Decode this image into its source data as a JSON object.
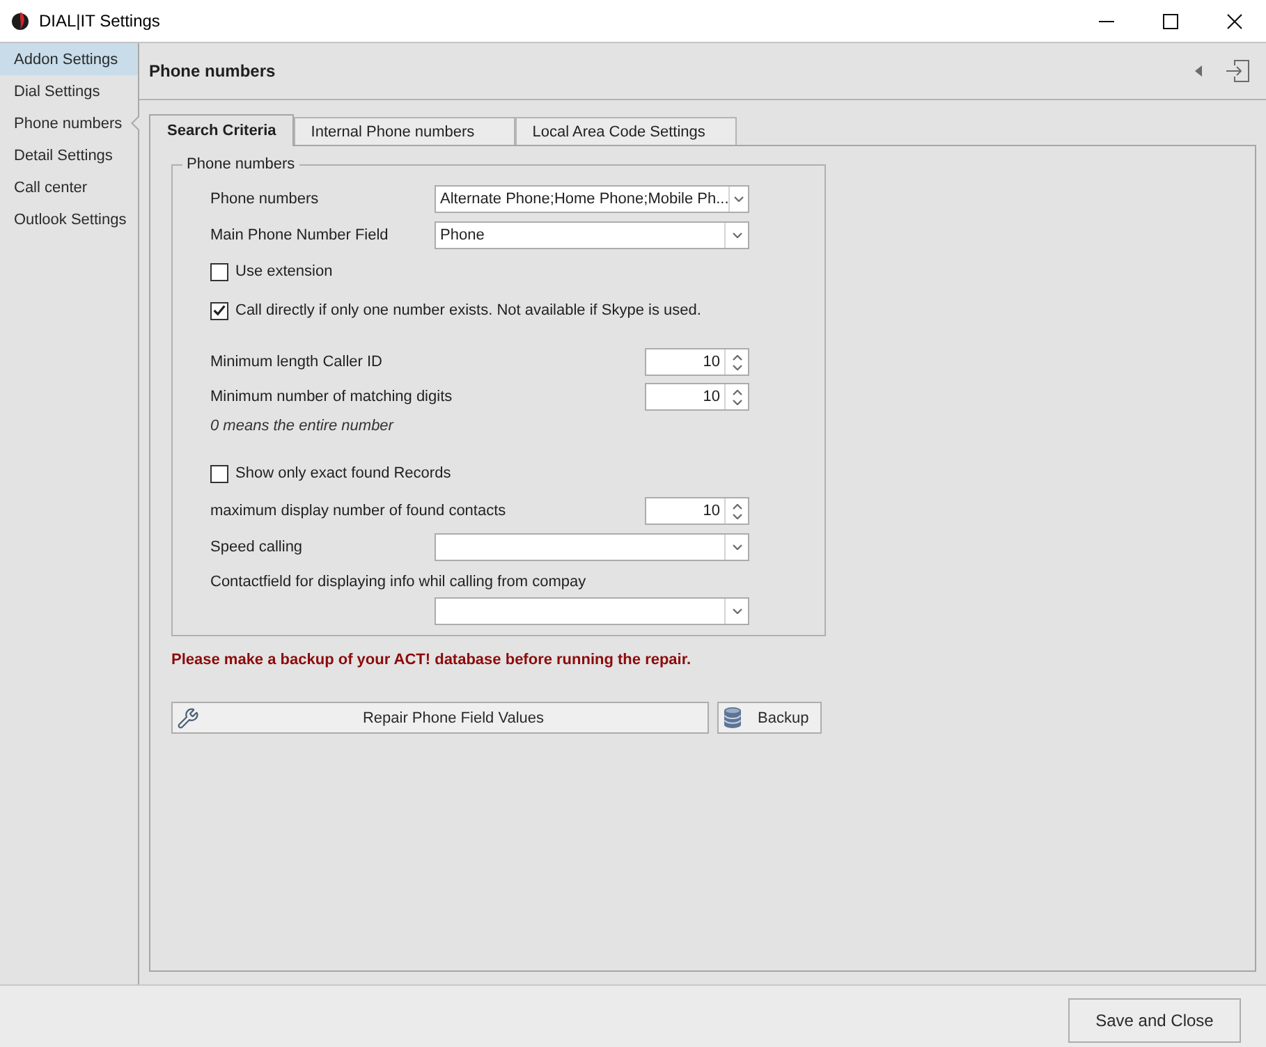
{
  "window": {
    "title": "DIAL|IT Settings"
  },
  "sidebar": {
    "items": [
      {
        "label": "Addon Settings",
        "highlighted": true,
        "selected": false
      },
      {
        "label": "Dial Settings",
        "highlighted": false,
        "selected": false
      },
      {
        "label": "Phone numbers",
        "highlighted": false,
        "selected": true
      },
      {
        "label": "Detail Settings",
        "highlighted": false,
        "selected": false
      },
      {
        "label": "Call center",
        "highlighted": false,
        "selected": false
      },
      {
        "label": "Outlook Settings",
        "highlighted": false,
        "selected": false
      }
    ]
  },
  "header": {
    "title": "Phone numbers"
  },
  "tabs": [
    {
      "label": "Search Criteria",
      "selected": true
    },
    {
      "label": "Internal Phone numbers",
      "selected": false
    },
    {
      "label": "Local Area Code Settings",
      "selected": false
    }
  ],
  "group": {
    "title": "Phone numbers",
    "sections": [
      [
        {
          "kind": "dropdown",
          "label": "Phone numbers",
          "value": "Alternate Phone;Home Phone;Mobile Ph..."
        },
        {
          "kind": "dropdown",
          "label": "Main Phone Number Field",
          "value": "Phone"
        },
        {
          "kind": "checkbox",
          "label": "Use extension",
          "checked": false
        },
        {
          "kind": "checkbox",
          "label": "Call directly if only one number exists. Not available if Skype is used.",
          "checked": true
        }
      ],
      [
        {
          "kind": "spinner",
          "label": "Minimum length Caller ID",
          "value": "10"
        },
        {
          "kind": "spinner",
          "label": "Minimum number of matching digits",
          "value": "10"
        },
        {
          "kind": "note",
          "text": "0 means the entire number"
        }
      ],
      [
        {
          "kind": "checkbox",
          "label": "Show only exact found Records",
          "checked": false
        },
        {
          "kind": "spinner",
          "label": "maximum display number of found contacts",
          "value": "10"
        },
        {
          "kind": "dropdown",
          "label": "Speed calling"
        },
        {
          "kind": "dropdown_below",
          "label": "Contactfield for displaying info whil calling from compay"
        }
      ]
    ]
  },
  "warning": "Please make a backup of your ACT! database before running the repair.",
  "actions": [
    {
      "kind": "repair",
      "label": "Repair Phone Field Values"
    },
    {
      "kind": "backup",
      "label": "Backup"
    }
  ],
  "footer": {
    "buttons": [
      "Save and Close"
    ]
  }
}
